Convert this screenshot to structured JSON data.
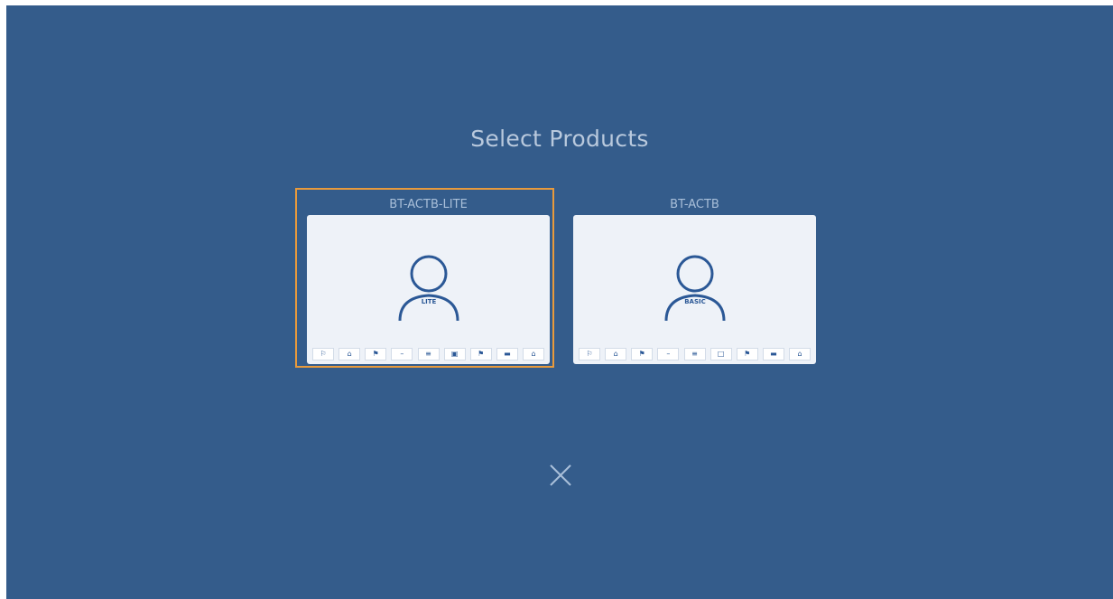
{
  "dialog": {
    "title": "Select Products",
    "close_icon": "close-icon"
  },
  "products": [
    {
      "name": "BT-ACTB-LITE",
      "badge": "LITE",
      "selected": true,
      "tools": [
        "⚐",
        "⌂",
        "⚑",
        "–",
        "≡",
        "▣",
        "⚑",
        "▬",
        "⌂"
      ]
    },
    {
      "name": "BT-ACTB",
      "badge": "BASIC",
      "selected": false,
      "tools": [
        "⚐",
        "⌂",
        "⚑",
        "–",
        "≡",
        "□",
        "⚑",
        "▬",
        "⌂"
      ]
    }
  ],
  "colors": {
    "background": "#345c8b",
    "selection": "#e89a3c",
    "card": "#eef2f8",
    "icon": "#2b5896"
  }
}
